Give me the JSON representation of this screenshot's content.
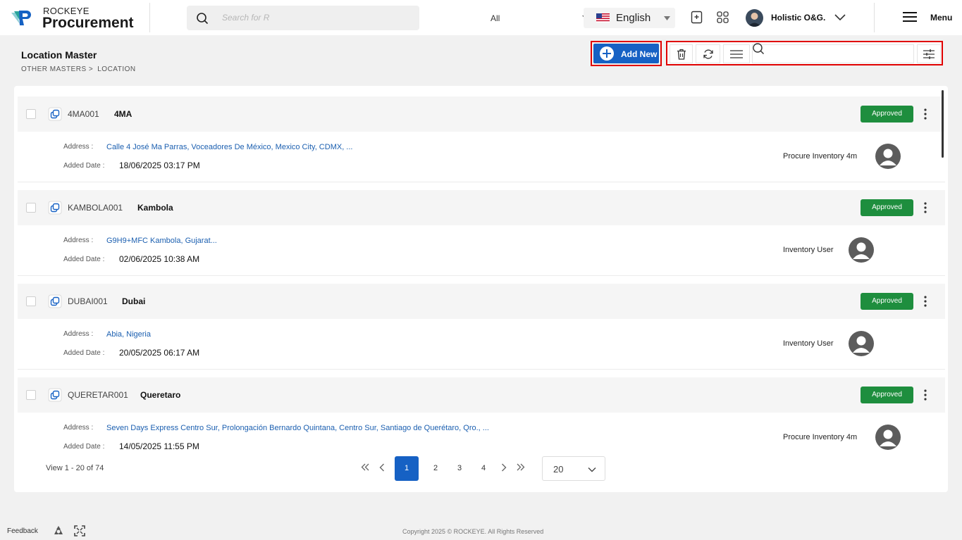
{
  "app": {
    "brand_small": "ROCKEYE",
    "brand_big": "Procurement"
  },
  "topbar": {
    "search_placeholder": "Search for R",
    "search_filter": "All",
    "language": "English",
    "user_name": "Holistic O&G.",
    "menu_label": "Menu"
  },
  "page": {
    "title": "Location Master",
    "breadcrumb": [
      "OTHER MASTERS >",
      "LOCATION"
    ],
    "add_new_label": "Add New",
    "search_placeholder": ""
  },
  "records": [
    {
      "code": "4MA001",
      "name": "4MA",
      "status": "Approved",
      "address_label": "Address :",
      "address": "Calle 4 José Ma Parras, Voceadores De México, Mexico City, CDMX, ...",
      "date_label": "Added Date :",
      "added_date": "18/06/2025 03:17 PM",
      "added_by": "Procure Inventory 4m"
    },
    {
      "code": "KAMBOLA001",
      "name": "Kambola",
      "status": "Approved",
      "address_label": "Address :",
      "address": "G9H9+MFC Kambola, Gujarat...",
      "date_label": "Added Date :",
      "added_date": "02/06/2025 10:38 AM",
      "added_by": "Inventory User"
    },
    {
      "code": "DUBAI001",
      "name": "Dubai",
      "status": "Approved",
      "address_label": "Address :",
      "address": "Abia, Nigeria",
      "date_label": "Added Date :",
      "added_date": "20/05/2025 06:17 AM",
      "added_by": "Inventory User"
    },
    {
      "code": "QUERETAR001",
      "name": "Queretaro",
      "status": "Approved",
      "address_label": "Address :",
      "address": "Seven Days Express Centro Sur, Prolongación Bernardo Quintana, Centro Sur, Santiago de Querétaro, Qro., ...",
      "date_label": "Added Date :",
      "added_date": "14/05/2025 11:55 PM",
      "added_by": "Procure Inventory 4m"
    }
  ],
  "pagination": {
    "view_text": "View 1 - 20 of 74",
    "pages": [
      "1",
      "2",
      "3",
      "4"
    ],
    "current_page": "1",
    "page_size": "20"
  },
  "footer": {
    "feedback": "Feedback",
    "copyright": "Copyright 2025 © ROCKEYE. All Rights Reserved"
  },
  "colors": {
    "primary": "#1661c4",
    "approved": "#1e8e3e",
    "highlight_border": "#e00000",
    "link": "#1b5fb0"
  },
  "icons": [
    "search-icon",
    "chevron-down-icon",
    "us-flag-icon",
    "bookmark-plus-icon",
    "apps-grid-icon",
    "hamburger-icon",
    "plus-icon",
    "trash-icon",
    "refresh-icon",
    "list-icon",
    "filter-sliders-icon",
    "copy-icon",
    "kebab-icon",
    "user-avatar-icon",
    "double-chevron-left-icon",
    "chevron-left-icon",
    "chevron-right-icon",
    "double-chevron-right-icon",
    "recycle-icon",
    "fullscreen-icon"
  ]
}
